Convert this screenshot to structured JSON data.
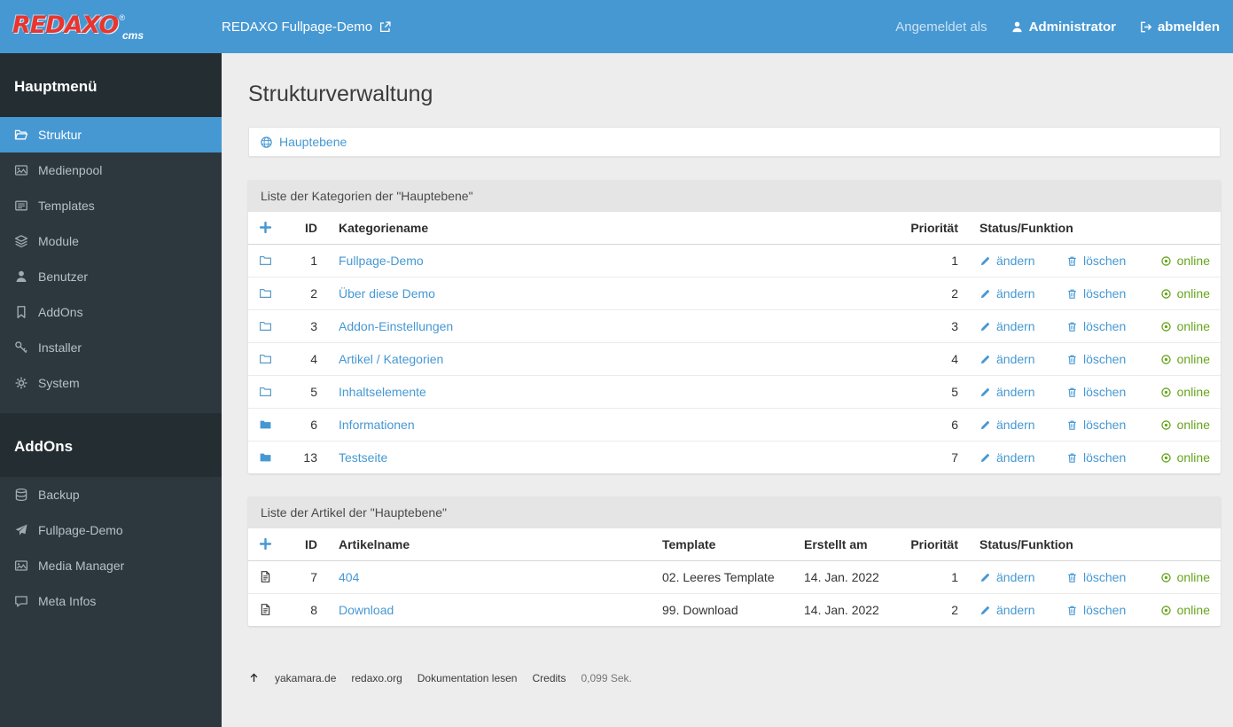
{
  "topbar": {
    "logo": {
      "brand": "REDAXO",
      "reg": "®",
      "sub": "cms"
    },
    "site_link": "REDAXO Fullpage-Demo",
    "logged_in_as": "Angemeldet als",
    "user": "Administrator",
    "logout": "abmelden"
  },
  "sidebar": {
    "sections": [
      {
        "title": "Hauptmenü",
        "items": [
          {
            "label": "Struktur",
            "icon": "folder-open",
            "active": true
          },
          {
            "label": "Medienpool",
            "icon": "image",
            "active": false
          },
          {
            "label": "Templates",
            "icon": "newspaper",
            "active": false
          },
          {
            "label": "Module",
            "icon": "layers",
            "active": false
          },
          {
            "label": "Benutzer",
            "icon": "user",
            "active": false
          },
          {
            "label": "AddOns",
            "icon": "bookmark",
            "active": false
          },
          {
            "label": "Installer",
            "icon": "key",
            "active": false
          },
          {
            "label": "System",
            "icon": "gears",
            "active": false
          }
        ]
      },
      {
        "title": "AddOns",
        "items": [
          {
            "label": "Backup",
            "icon": "database",
            "active": false
          },
          {
            "label": "Fullpage-Demo",
            "icon": "plane",
            "active": false
          },
          {
            "label": "Media Manager",
            "icon": "image",
            "active": false
          },
          {
            "label": "Meta Infos",
            "icon": "comment",
            "active": false
          }
        ]
      }
    ]
  },
  "main": {
    "page_title": "Strukturverwaltung",
    "breadcrumb": {
      "root": "Hauptebene"
    },
    "categories_panel": {
      "title": "Liste der Kategorien der \"Hauptebene\"",
      "columns": {
        "id": "ID",
        "name": "Kategoriename",
        "priority": "Priorität",
        "status": "Status/Funktion"
      },
      "actions": {
        "edit": "ändern",
        "delete": "löschen"
      },
      "rows": [
        {
          "id": "1",
          "name": "Fullpage-Demo",
          "priority": "1",
          "icon": "folder",
          "status": "online"
        },
        {
          "id": "2",
          "name": "Über diese Demo",
          "priority": "2",
          "icon": "folder",
          "status": "online"
        },
        {
          "id": "3",
          "name": "Addon-Einstellungen",
          "priority": "3",
          "icon": "folder",
          "status": "online"
        },
        {
          "id": "4",
          "name": "Artikel / Kategorien",
          "priority": "4",
          "icon": "folder",
          "status": "online"
        },
        {
          "id": "5",
          "name": "Inhaltselemente",
          "priority": "5",
          "icon": "folder",
          "status": "online"
        },
        {
          "id": "6",
          "name": "Informationen",
          "priority": "6",
          "icon": "folder-solid",
          "status": "online"
        },
        {
          "id": "13",
          "name": "Testseite",
          "priority": "7",
          "icon": "folder-solid",
          "status": "online"
        }
      ]
    },
    "articles_panel": {
      "title": "Liste der Artikel der \"Hauptebene\"",
      "columns": {
        "id": "ID",
        "name": "Artikelname",
        "template": "Template",
        "created": "Erstellt am",
        "priority": "Priorität",
        "status": "Status/Funktion"
      },
      "actions": {
        "edit": "ändern",
        "delete": "löschen"
      },
      "rows": [
        {
          "id": "7",
          "name": "404",
          "template": "02. Leeres Template",
          "created": "14. Jan. 2022",
          "priority": "1",
          "icon": "file-text",
          "status": "online"
        },
        {
          "id": "8",
          "name": "Download",
          "template": "99. Download",
          "created": "14. Jan. 2022",
          "priority": "2",
          "icon": "file-text",
          "status": "online"
        }
      ]
    }
  },
  "footer": {
    "links": [
      "yakamara.de",
      "redaxo.org",
      "Dokumentation lesen",
      "Credits"
    ],
    "time": "0,099 Sek."
  }
}
